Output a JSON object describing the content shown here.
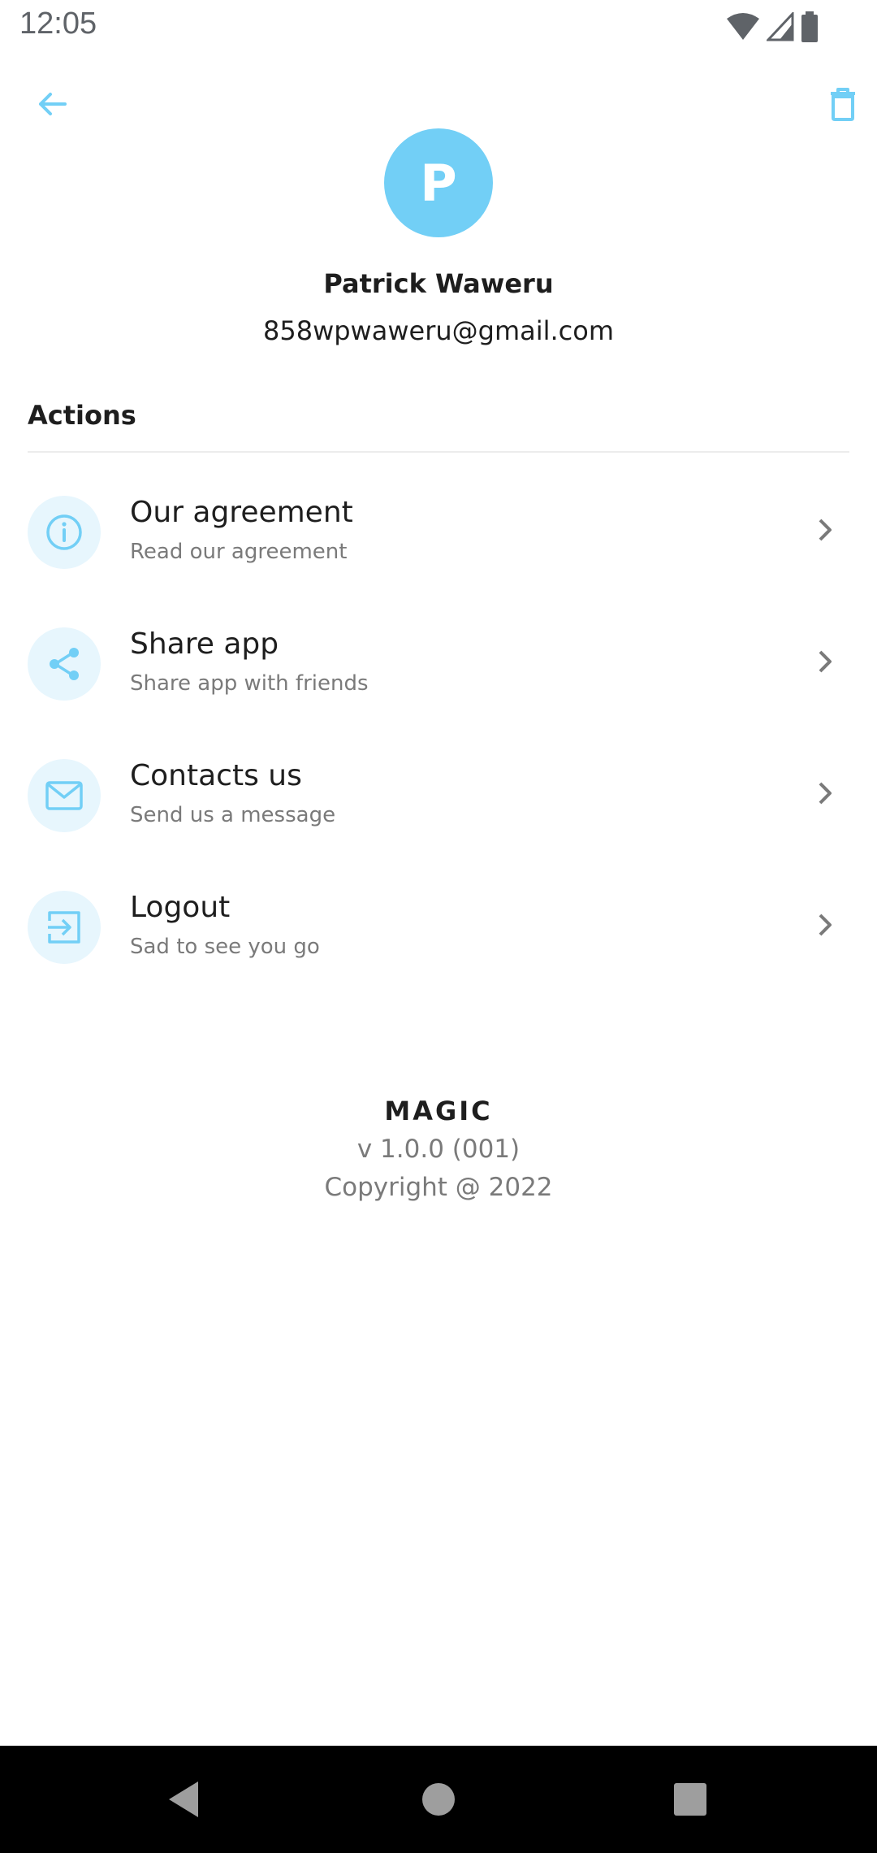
{
  "status_bar": {
    "time": "12:05",
    "icons": [
      "wifi-icon",
      "cellular-signal-icon",
      "battery-icon"
    ]
  },
  "app_bar": {
    "back_icon": "arrow-left-icon",
    "delete_icon": "trash-icon"
  },
  "profile": {
    "avatar_letter": "P",
    "name": "Patrick Waweru",
    "email": "858wpwaweru@gmail.com"
  },
  "actions": {
    "section_title": "Actions",
    "items": [
      {
        "title": "Our agreement",
        "subtitle": "Read our agreement",
        "icon": "info-icon"
      },
      {
        "title": "Share app",
        "subtitle": "Share app with friends",
        "icon": "share-icon"
      },
      {
        "title": "Contacts us",
        "subtitle": "Send us a message",
        "icon": "mail-icon"
      },
      {
        "title": "Logout",
        "subtitle": "Sad to see you go",
        "icon": "logout-icon"
      }
    ]
  },
  "footer": {
    "app_name": "MAGIC",
    "version": "v 1.0.0 (001)",
    "copyright": "Copyright @ 2022"
  },
  "colors": {
    "accent": "#72cff6",
    "icon_bg": "#e7f6fd",
    "text_primary": "#1e1e1e",
    "text_secondary": "#7a7a7a"
  }
}
